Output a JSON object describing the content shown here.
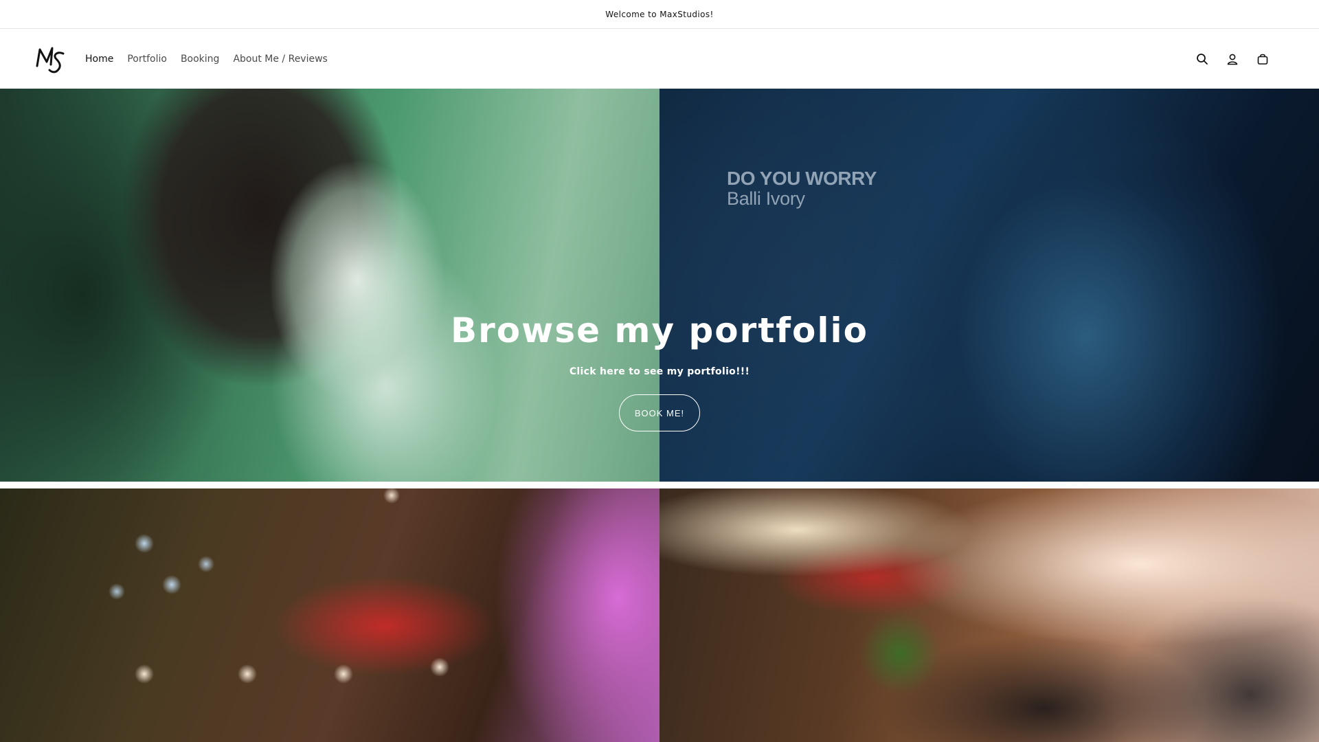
{
  "announcement": {
    "text": "Welcome to MaxStudios!"
  },
  "header": {
    "logo_alt": "MS",
    "nav": [
      {
        "label": "Home",
        "active": true
      },
      {
        "label": "Portfolio",
        "active": false
      },
      {
        "label": "Booking",
        "active": false
      },
      {
        "label": "About Me / Reviews",
        "active": false
      }
    ],
    "icons": [
      "search-icon",
      "account-icon",
      "cart-icon"
    ]
  },
  "hero": {
    "poster_line1": "DO YOU WORRY",
    "poster_line2": "Balli Ivory",
    "title": "Browse my portfolio",
    "subtitle": "Click here to see my portfolio!!!",
    "button_label": "BOOK ME!"
  },
  "colors": {
    "text": "#121212",
    "nav_inactive": "#4a4a4a",
    "border": "#e6e6e6",
    "hero_text": "#ffffff"
  }
}
